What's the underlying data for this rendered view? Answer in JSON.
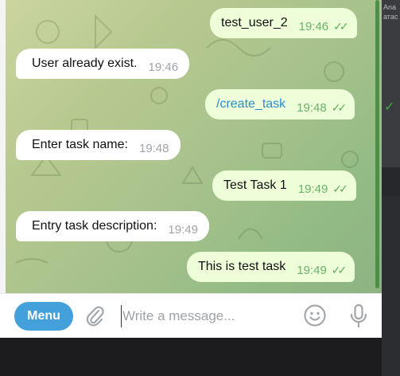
{
  "background": {
    "peek_texts": [
      "Ana",
      "атас"
    ],
    "peek_check": "✓"
  },
  "chat": {
    "messages": [
      {
        "direction": "out",
        "text": "test_user_2",
        "time": "19:46",
        "read": true
      },
      {
        "direction": "in",
        "text": "User already exist.",
        "time": "19:46"
      },
      {
        "direction": "out",
        "text": "/create_task",
        "time": "19:48",
        "read": true,
        "is_command": true
      },
      {
        "direction": "in",
        "text": "Enter task name:",
        "time": "19:48"
      },
      {
        "direction": "out",
        "text": "Test Task 1",
        "time": "19:49",
        "read": true
      },
      {
        "direction": "in",
        "text": "Entry task description:",
        "time": "19:49"
      },
      {
        "direction": "out",
        "text": "This is test task",
        "time": "19:49",
        "read": true
      }
    ],
    "read_mark": "✓✓"
  },
  "input_bar": {
    "menu_label": "Menu",
    "placeholder": "Write a message...",
    "value": "",
    "icons": [
      "paperclip-icon",
      "emoji-icon",
      "microphone-icon"
    ]
  },
  "colors": {
    "accent": "#44a0db",
    "outgoing_bubble": "#eefed8",
    "incoming_bubble": "#ffffff",
    "read_check": "#5eae58",
    "command_link": "#2c8ed1"
  }
}
